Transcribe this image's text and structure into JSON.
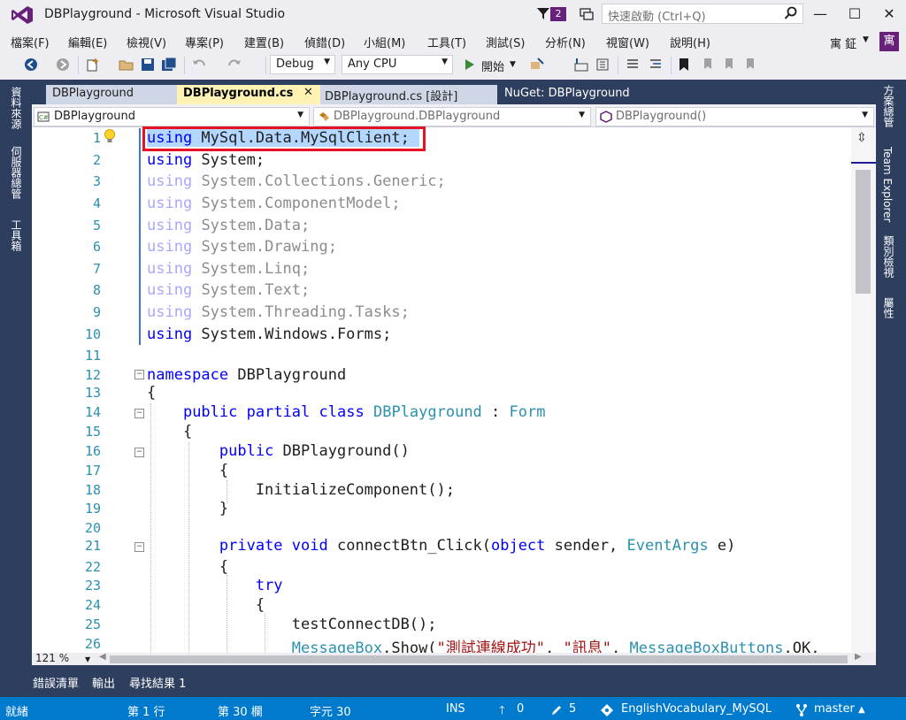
{
  "title": "DBPlayground - Microsoft Visual Studio",
  "notification_count": "2",
  "quick_launch": {
    "placeholder": "快速啟動 (Ctrl+Q)"
  },
  "window_controls": {
    "minimize": "—",
    "maximize": "☐",
    "close": "✕"
  },
  "menu": [
    "檔案(F)",
    "編輯(E)",
    "檢視(V)",
    "專案(P)",
    "建置(B)",
    "偵錯(D)",
    "小組(M)",
    "工具(T)",
    "測試(S)",
    "分析(N)",
    "視窗(W)",
    "說明(H)"
  ],
  "user": {
    "name": "寓 鉦",
    "avatar": "寓"
  },
  "toolbar": {
    "config": "Debug",
    "platform": "Any CPU",
    "start": "開始"
  },
  "left_dock": [
    "資料來源",
    "伺服器總管",
    "工具箱"
  ],
  "right_dock": [
    "方案總管",
    "Team Explorer",
    "類別檢視",
    "屬性"
  ],
  "tabs": [
    {
      "label": "DBPlayground"
    },
    {
      "label": "DBPlayground.cs"
    },
    {
      "label": "DBPlayground.cs [設計]"
    },
    {
      "label": "NuGet: DBPlayground"
    }
  ],
  "nav": {
    "project": "DBPlayground",
    "class": "DBPlayground.DBPlayground",
    "member": "DBPlayground()"
  },
  "code_lines": [
    {
      "n": "1",
      "html": "<span class=\"kw\">using</span> MySql.Data.MySqlClient;"
    },
    {
      "n": "2",
      "html": "<span class=\"kw\">using</span> System;"
    },
    {
      "n": "3",
      "html": "<span class=\"dimkw\">using</span> <span class=\"dim\">System.Collections.Generic;</span>"
    },
    {
      "n": "4",
      "html": "<span class=\"dimkw\">using</span> <span class=\"dim\">System.ComponentModel;</span>"
    },
    {
      "n": "5",
      "html": "<span class=\"dimkw\">using</span> <span class=\"dim\">System.Data;</span>"
    },
    {
      "n": "6",
      "html": "<span class=\"dimkw\">using</span> <span class=\"dim\">System.Drawing;</span>"
    },
    {
      "n": "7",
      "html": "<span class=\"dimkw\">using</span> <span class=\"dim\">System.Linq;</span>"
    },
    {
      "n": "8",
      "html": "<span class=\"dimkw\">using</span> <span class=\"dim\">System.Text;</span>"
    },
    {
      "n": "9",
      "html": "<span class=\"dimkw\">using</span> <span class=\"dim\">System.Threading.Tasks;</span>"
    },
    {
      "n": "10",
      "html": "<span class=\"kw\">using</span> System.Windows.Forms;"
    },
    {
      "n": "11",
      "html": ""
    },
    {
      "n": "12",
      "html": "<span class=\"kw\">namespace</span> DBPlayground"
    },
    {
      "n": "13",
      "html": "{"
    },
    {
      "n": "14",
      "html": "    <span class=\"kw\">public</span> <span class=\"kw\">partial</span> <span class=\"kw\">class</span> <span class=\"ty\">DBPlayground</span> : <span class=\"ty\">Form</span>"
    },
    {
      "n": "15",
      "html": "    {"
    },
    {
      "n": "16",
      "html": "        <span class=\"kw\">public</span> DBPlayground()"
    },
    {
      "n": "17",
      "html": "        {"
    },
    {
      "n": "18",
      "html": "            InitializeComponent();"
    },
    {
      "n": "19",
      "html": "        }"
    },
    {
      "n": "20",
      "html": ""
    },
    {
      "n": "21",
      "html": "        <span class=\"kw\">private</span> <span class=\"kw\">void</span> connectBtn_Click(<span class=\"kw\">object</span> sender, <span class=\"ty\">EventArgs</span> e)"
    },
    {
      "n": "22",
      "html": "        {"
    },
    {
      "n": "23",
      "html": "            <span class=\"kw\">try</span>"
    },
    {
      "n": "24",
      "html": "            {"
    },
    {
      "n": "25",
      "html": "                testConnectDB();"
    },
    {
      "n": "26",
      "html": "                <span class=\"ty\">MessageBox</span>.Show(<span class=\"str\">\"測試連線成功\"</span>, <span class=\"str\">\"訊息\"</span>, <span class=\"ty\">MessageBoxButtons</span>.OK,"
    }
  ],
  "zoom": "121 %",
  "output_tabs": [
    "錯誤清單",
    "輸出",
    "尋找結果 1"
  ],
  "status": {
    "ready": "就緒",
    "line": "第 1 行",
    "col": "第 30 欄",
    "char": "字元 30",
    "ins": "INS",
    "up_count": "0",
    "edit_count": "5",
    "repo": "EnglishVocabulary_MySQL",
    "branch": "master"
  },
  "colors": {
    "accent": "#68217a",
    "status": "#007acc",
    "dock": "#2d3e5f",
    "highlight": "#e81123"
  }
}
